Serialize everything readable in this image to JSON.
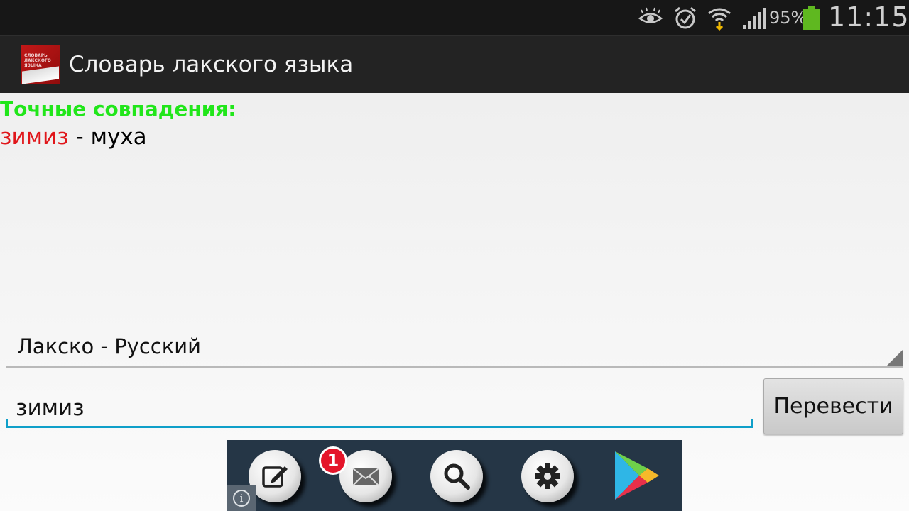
{
  "status_bar": {
    "icons": [
      "eye-icon",
      "alarm-icon",
      "wifi-icon",
      "signal-icon",
      "battery-icon"
    ],
    "battery_percent": "95%",
    "time": "11:15",
    "battery_color": "#5fb820"
  },
  "action_bar": {
    "app_icon_text": "СЛОВАРЬ ЛАКСКОГО ЯЗЫКА",
    "title": "Словарь лакского языка"
  },
  "results": {
    "heading": "Точные совпадения:",
    "items": [
      {
        "word": "зимиз",
        "separator": " - ",
        "translation": "муха"
      }
    ]
  },
  "language_selector": {
    "selected": "Лакско - Русский"
  },
  "search": {
    "value": "зимиз",
    "button_label": "Перевести"
  },
  "ad_banner": {
    "buttons": [
      "edit-icon",
      "mail-icon",
      "search-icon",
      "gear-icon",
      "play-store-icon"
    ],
    "notification_count": "1",
    "info_label": "i"
  },
  "colors": {
    "heading_green": "#21e61a",
    "word_red": "#e0161a",
    "input_accent": "#0f9fc9"
  }
}
